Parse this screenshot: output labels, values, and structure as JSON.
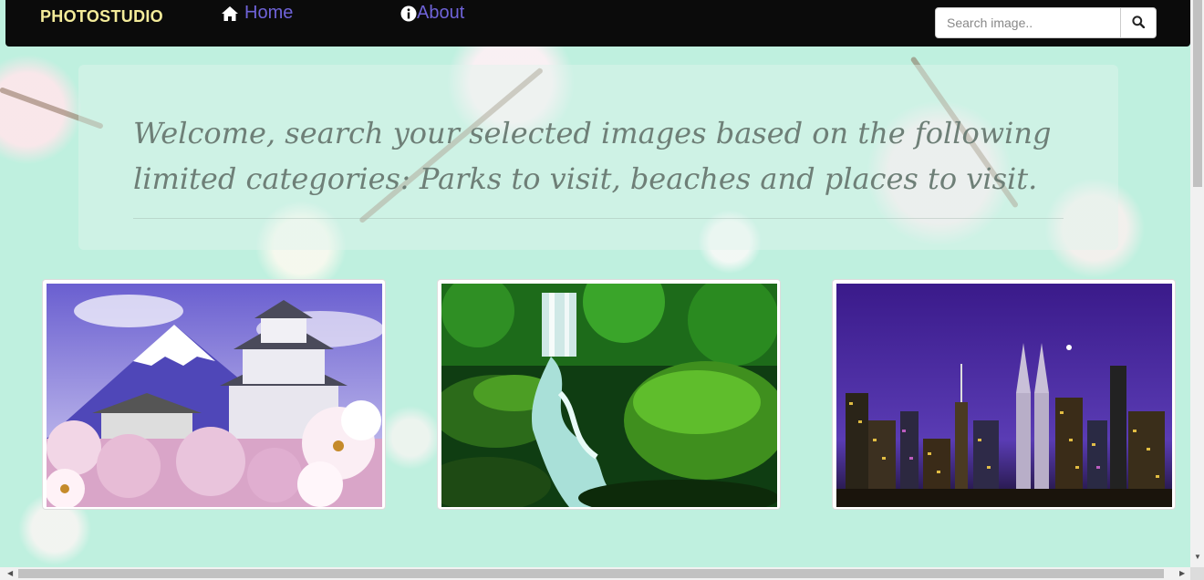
{
  "navbar": {
    "brand": "PHOTOSTUDIO",
    "links": [
      {
        "label": "Home",
        "icon": "home-icon"
      },
      {
        "label": "About",
        "icon": "info-icon"
      }
    ],
    "search": {
      "placeholder": "Search image..",
      "value": "",
      "button_icon": "search-icon"
    }
  },
  "jumbotron": {
    "welcome_text": "Welcome, search your selected images based on the following limited categories: Parks to visit, beaches and places to visit."
  },
  "gallery": [
    {
      "subject": "japanese-castle-with-mount-fuji-image"
    },
    {
      "subject": "forest-waterfall-image"
    },
    {
      "subject": "city-skyline-at-night-image"
    }
  ],
  "colors": {
    "navbar_bg": "#0b0b0b",
    "brand": "#f4ec9a",
    "nav_link": "#6f63d8",
    "page_bg": "#bff0df",
    "welcome_text": "#6e7f77"
  }
}
